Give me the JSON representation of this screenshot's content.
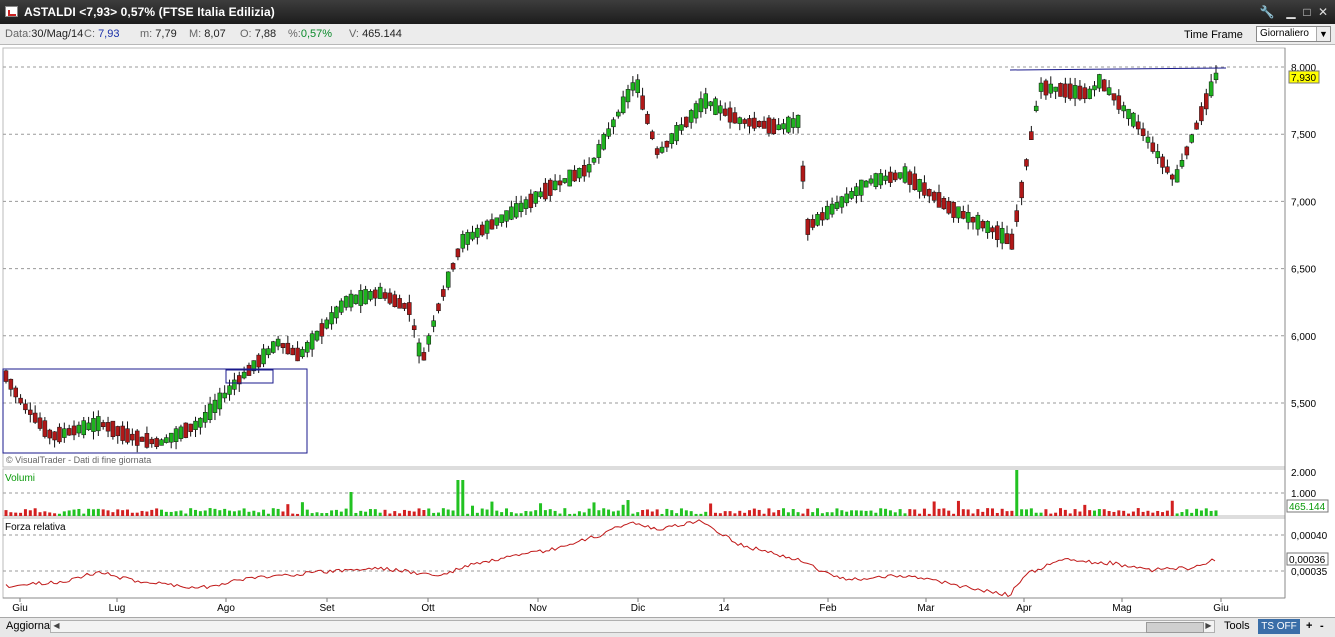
{
  "window": {
    "title": "ASTALDI <7,93> 0,57%  (FTSE Italia Edilizia)",
    "buttons": [
      "wrench-icon",
      "minimize-icon",
      "maximize-icon",
      "close-icon"
    ]
  },
  "infobar": {
    "data_label": "Data:",
    "data_value": "30/Mag/14",
    "c_label": "C:",
    "c_value": "7,93",
    "m_label": "m:",
    "m_value": "7,79",
    "M_label": "M:",
    "M_value": "8,07",
    "o_label": "O:",
    "o_value": "7,88",
    "pct_label": "%:",
    "pct_value": "0,57%",
    "v_label": "V:",
    "v_value": "465.144",
    "timeframe_label": "Time Frame",
    "timeframe_value": "Giornaliero"
  },
  "chart_data": {
    "type": "candlestick",
    "copyright": "© VisualTrader - Dati di fine giornata",
    "xticks": [
      "Giu",
      "Lug",
      "Ago",
      "Set",
      "Ott",
      "Nov",
      "Dic",
      "14",
      "Feb",
      "Mar",
      "Apr",
      "Mag",
      "Giu"
    ],
    "price_axis": {
      "ticks": [
        "8,000",
        "7,500",
        "7,000",
        "6,500",
        "6,000",
        "5,500"
      ],
      "range": [
        5.0,
        8.1
      ]
    },
    "last_price_label": "7,930",
    "close_path": [
      [
        "Giu",
        5.7
      ],
      [
        "Giu",
        5.5
      ],
      [
        "Giu",
        5.25
      ],
      [
        "Lug",
        5.35
      ],
      [
        "Lug",
        5.25
      ],
      [
        "Lug",
        5.2
      ],
      [
        "Ago",
        5.35
      ],
      [
        "Ago",
        5.65
      ],
      [
        "Ago",
        5.95
      ],
      [
        "Set",
        5.85
      ],
      [
        "Set",
        6.25
      ],
      [
        "Set",
        6.32
      ],
      [
        "Ott",
        6.2
      ],
      [
        "Ott",
        5.8
      ],
      [
        "Ott",
        6.25
      ],
      [
        "Ott",
        6.7
      ],
      [
        "Nov",
        6.95
      ],
      [
        "Nov",
        7.1
      ],
      [
        "Nov",
        7.25
      ],
      [
        "Dic",
        7.9
      ],
      [
        "Dic",
        7.35
      ],
      [
        "Dic",
        7.75
      ],
      [
        "14",
        7.6
      ],
      [
        "14",
        7.55
      ],
      [
        "14",
        7.6
      ],
      [
        "Feb",
        6.8
      ],
      [
        "Feb",
        7.15
      ],
      [
        "Feb",
        7.2
      ],
      [
        "Mar",
        6.95
      ],
      [
        "Mar",
        6.8
      ],
      [
        "Mar",
        6.7
      ],
      [
        "Apr",
        7.1
      ],
      [
        "Apr",
        7.85
      ],
      [
        "Apr",
        7.8
      ],
      [
        "Mag",
        7.9
      ],
      [
        "Mag",
        7.55
      ],
      [
        "Mag",
        7.15
      ],
      [
        "Giu",
        7.93
      ]
    ],
    "volume_panel": {
      "title": "Volumi",
      "ticks": [
        "2.000",
        "1.000"
      ],
      "last_label": "465.144"
    },
    "rs_panel": {
      "title": "Forza relativa",
      "ticks": [
        "0,00040",
        "0,00035"
      ],
      "last_label": "0,00036"
    },
    "grid": true
  },
  "statusbar": {
    "aggiorna": "Aggiorna",
    "tools": "Tools",
    "ts_off": "TS OFF",
    "plus": "+",
    "minus": "-"
  }
}
